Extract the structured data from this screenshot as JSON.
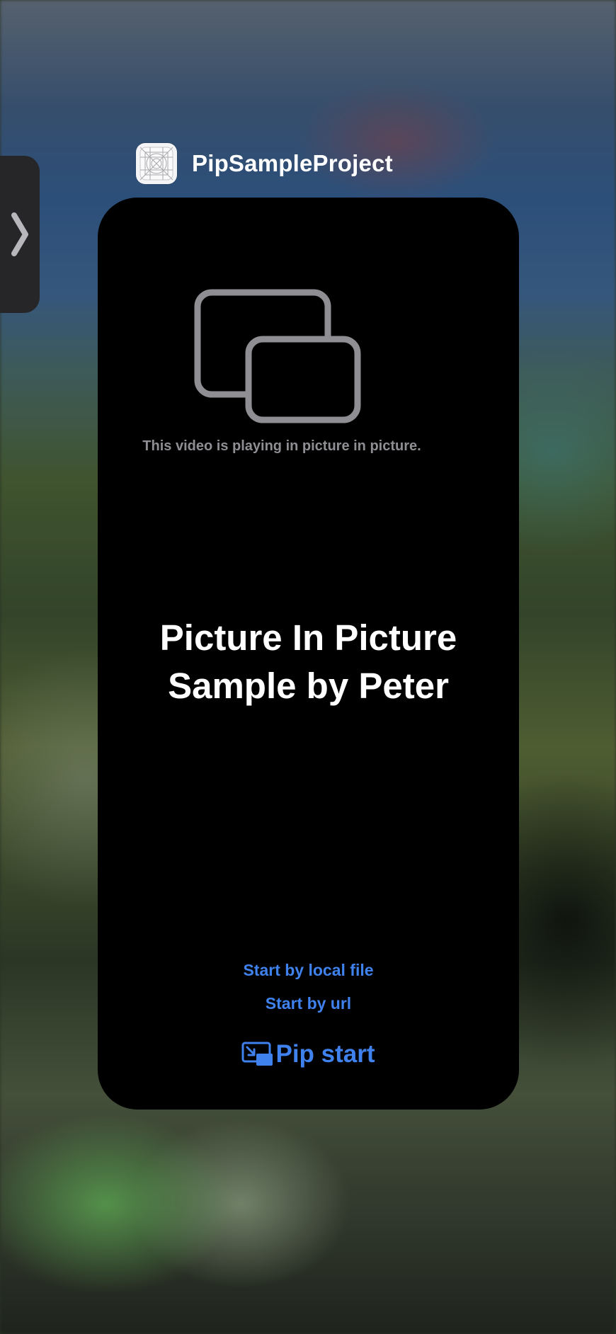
{
  "app": {
    "name": "PipSampleProject",
    "icon": "app-blueprint-icon"
  },
  "side_tab": {
    "icon": "chevron-right-icon"
  },
  "card": {
    "placeholder_icon": "picture-in-picture-icon",
    "pip_caption": "This video is playing in picture in picture.",
    "title_line1": "Picture In Picture",
    "title_line2": "Sample by Peter",
    "buttons": {
      "local_file": "Start by local file",
      "url": "Start by url",
      "pip_start": "Pip start",
      "pip_start_icon": "pip-enter-icon"
    }
  },
  "colors": {
    "accent": "#3f82ee",
    "card_background": "#000000",
    "caption": "#8e8e93",
    "title": "#ffffff"
  }
}
